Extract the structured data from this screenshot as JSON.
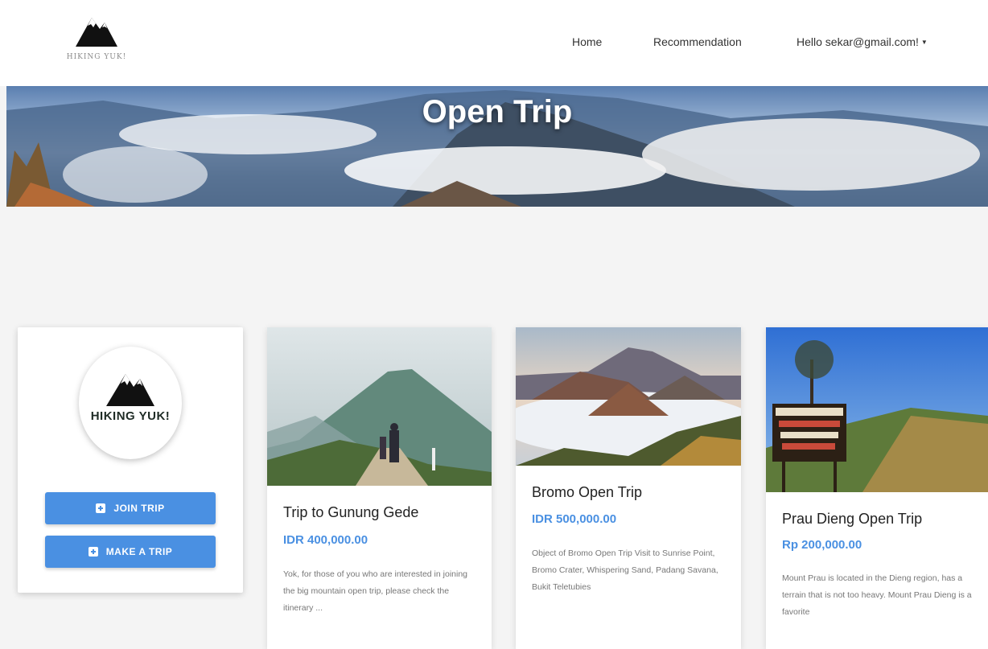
{
  "nav": {
    "logo_text": "HIKING YUK!",
    "home": "Home",
    "recommendation": "Recommendation",
    "user_greeting": "Hello sekar@gmail.com!"
  },
  "hero": {
    "title": "Open Trip"
  },
  "sidebar": {
    "logo_text": "HIKING YUK!",
    "join_label": "JOIN TRIP",
    "make_label": "MAKE A TRIP"
  },
  "trips": [
    {
      "title": "Trip to Gunung Gede",
      "price": "IDR 400,000.00",
      "description": "Yok, for those of you who are interested in joining the big mountain open trip, please check the itinerary ..."
    },
    {
      "title": "Bromo Open Trip",
      "price": "IDR 500,000.00",
      "description": "Object of Bromo Open Trip Visit to Sunrise Point, Bromo Crater, Whispering Sand, Padang Savana, Bukit Teletubies"
    },
    {
      "title": "Prau Dieng Open Trip",
      "price": "Rp 200,000.00",
      "description": "Mount Prau is located in the Dieng region, has a terrain that is not too heavy. Mount Prau Dieng is a favorite"
    }
  ],
  "colors": {
    "accent": "#4a90e2"
  },
  "icons": [
    "mountain-logo-icon",
    "caret-down-icon",
    "plus-square-icon"
  ]
}
